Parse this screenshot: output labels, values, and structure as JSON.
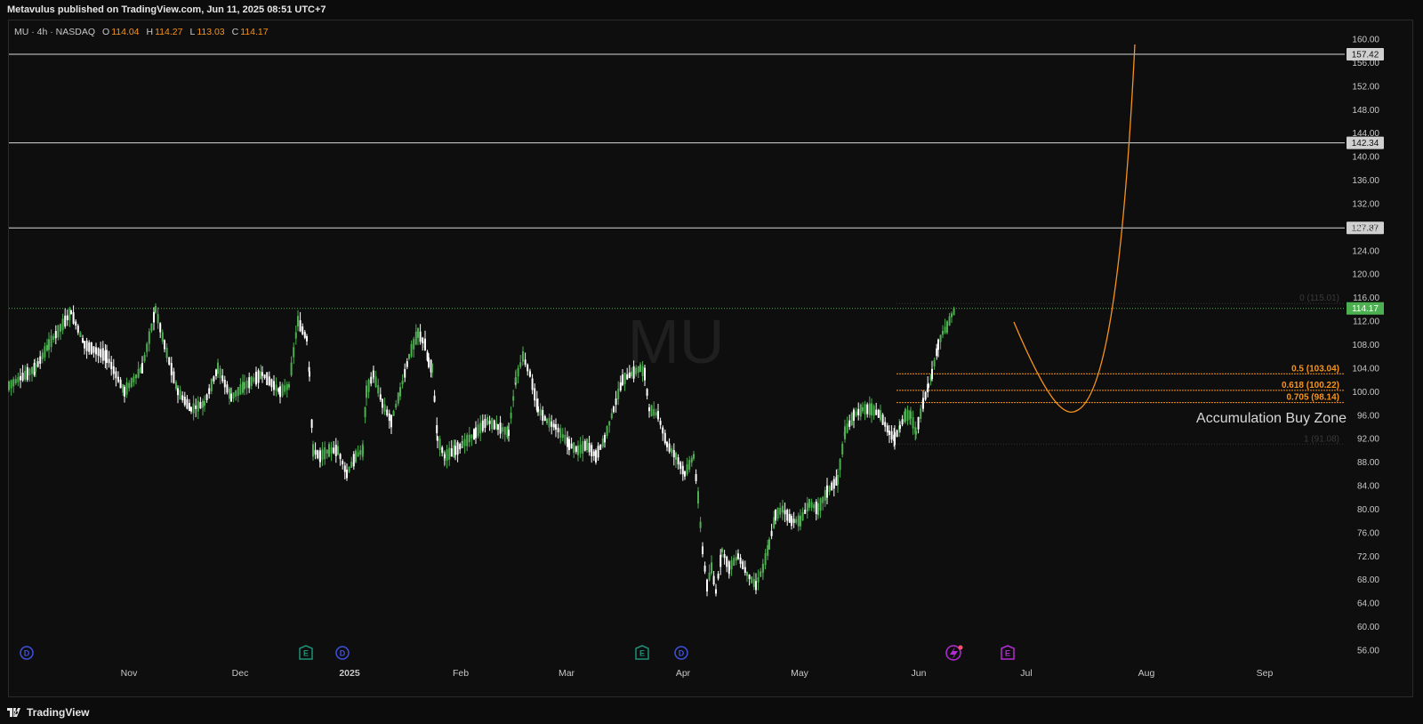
{
  "header": {
    "published": "Metavulus published on TradingView.com, Jun 11, 2025 08:51 UTC+7"
  },
  "legend": {
    "symbol": "MU · 4h · NASDAQ",
    "open_label": "O",
    "open": "114.04",
    "high_label": "H",
    "high": "114.27",
    "low_label": "L",
    "low": "113.03",
    "close_label": "C",
    "close": "114.17"
  },
  "watermark": "MU",
  "colors": {
    "up": "#4caf50",
    "down": "#ffffff",
    "fib": "#f7931a",
    "last_price": "#4caf50",
    "level_line": "#d8d8d8"
  },
  "price_axis": {
    "ticks": [
      "160.00",
      "156.00",
      "152.00",
      "148.00",
      "144.00",
      "140.00",
      "136.00",
      "132.00",
      "128.00",
      "124.00",
      "120.00",
      "116.00",
      "112.00",
      "108.00",
      "104.00",
      "100.00",
      "96.00",
      "92.00",
      "88.00",
      "84.00",
      "80.00",
      "76.00",
      "72.00",
      "68.00",
      "64.00",
      "60.00",
      "56.00"
    ]
  },
  "time_axis": {
    "ticks": [
      "Nov",
      "Dec",
      "2025",
      "Feb",
      "Mar",
      "Apr",
      "May",
      "Jun",
      "Jul",
      "Aug",
      "Sep"
    ]
  },
  "levels": [
    {
      "label": "157.42",
      "value": 157.42
    },
    {
      "label": "142.34",
      "value": 142.34
    },
    {
      "label": "127.87",
      "value": 127.87
    }
  ],
  "last_price": {
    "label": "114.17",
    "value": 114.17
  },
  "fib": [
    {
      "label": "0 (115.01)",
      "value": 115.01,
      "style": "dim"
    },
    {
      "label": "0.5 (103.04)",
      "value": 103.04,
      "style": "orange"
    },
    {
      "label": "0.618 (100.22)",
      "value": 100.22,
      "style": "orange"
    },
    {
      "label": "0.705 (98.14)",
      "value": 98.14,
      "style": "orange"
    },
    {
      "label": "1 (91.08)",
      "value": 91.08,
      "style": "dim"
    }
  ],
  "annotation": "Accumulation Buy Zone",
  "events": [
    {
      "type": "D",
      "color": "#3f51d9"
    },
    {
      "type": "E",
      "color": "#1e8f74"
    },
    {
      "type": "D",
      "color": "#3f51d9"
    },
    {
      "type": "E",
      "color": "#1e8f74"
    },
    {
      "type": "D",
      "color": "#3f51d9"
    },
    {
      "type": "E",
      "color": "#b52bd4"
    }
  ],
  "projection_icon": "lightning-replay-icon",
  "footer": {
    "brand": "TradingView"
  }
}
